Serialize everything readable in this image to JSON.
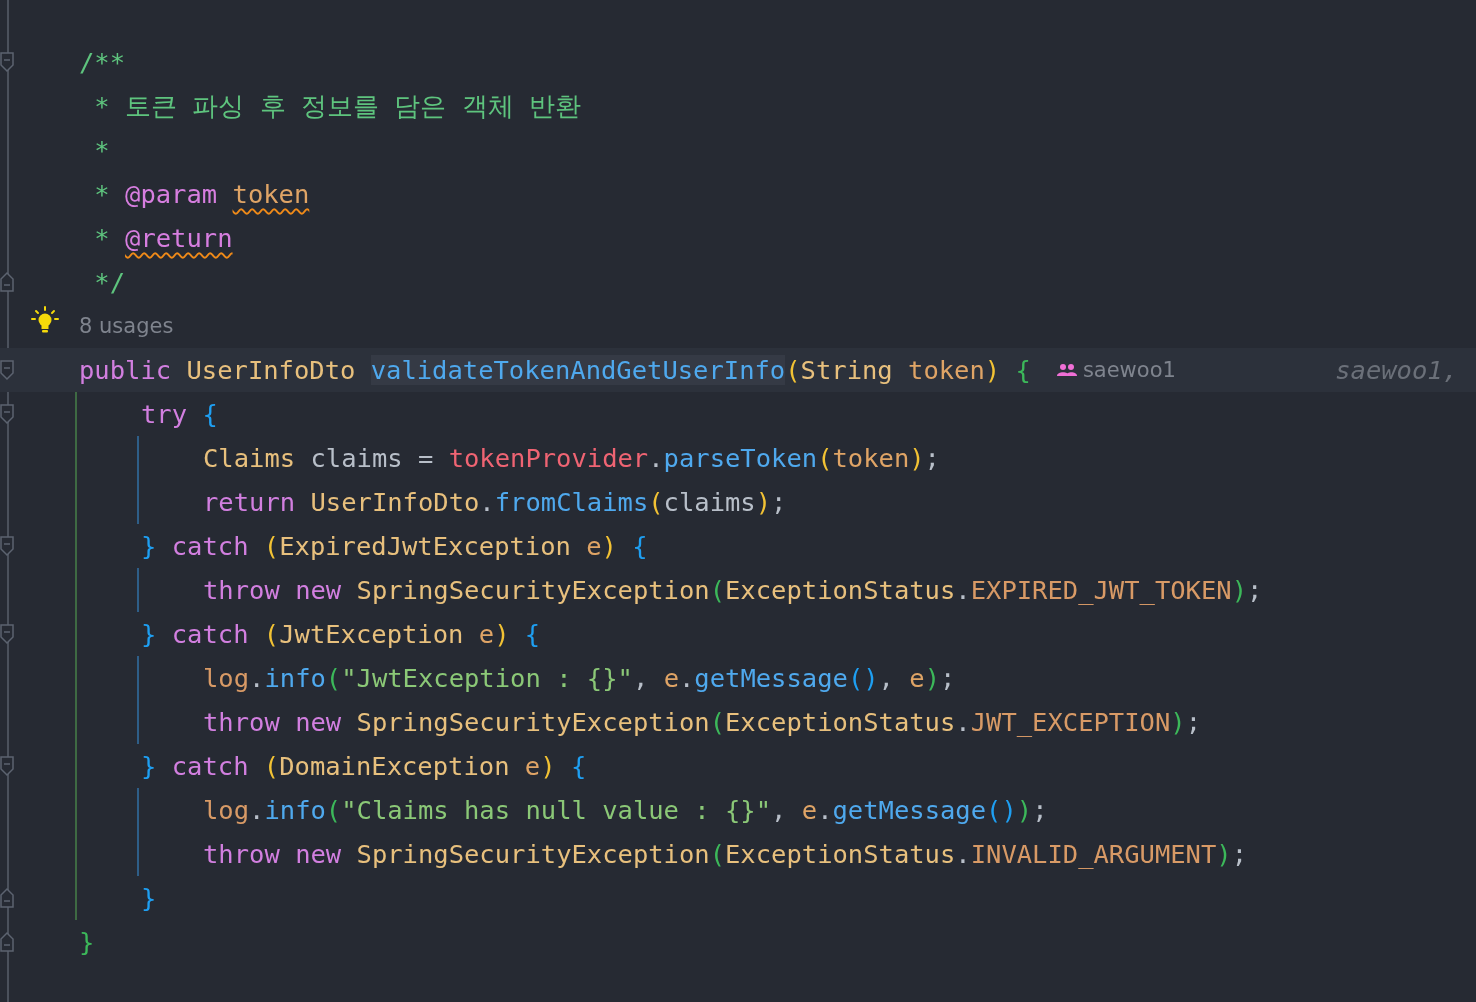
{
  "lines": [
    {
      "kind": "code",
      "fold_open": true,
      "tokens": [
        {
          "text": "/**",
          "kind": "comment"
        }
      ]
    },
    {
      "kind": "code",
      "tokens": [
        {
          "text": " * 토큰 파싱 후 정보를 담은 객체 반환",
          "kind": "comment"
        }
      ]
    },
    {
      "kind": "code",
      "tokens": [
        {
          "text": " *",
          "kind": "comment"
        }
      ]
    },
    {
      "kind": "code",
      "tokens": [
        {
          "text": " * ",
          "kind": "comment"
        },
        {
          "text": "@param ",
          "kind": "doc-tag"
        },
        {
          "text": "token",
          "kind": "param",
          "warning": true
        }
      ]
    },
    {
      "kind": "code",
      "tokens": [
        {
          "text": " * ",
          "kind": "comment"
        },
        {
          "text": "@return",
          "kind": "doc-tag",
          "warning": true
        }
      ]
    },
    {
      "kind": "code",
      "fold_close": true,
      "tokens": [
        {
          "text": " */",
          "kind": "comment"
        }
      ]
    },
    {
      "kind": "usages",
      "text": "8 usages"
    },
    {
      "kind": "code",
      "fold_open": true,
      "current": true,
      "author": "saewoo1",
      "blame": "saewoo1,",
      "tokens": [
        {
          "text": "public ",
          "kind": "keyword"
        },
        {
          "text": "UserInfoDto ",
          "kind": "type"
        },
        {
          "text": "validateTokenAndGetUserInfo",
          "kind": "method-decl"
        },
        {
          "text": "(",
          "kind": "bracket-yellow"
        },
        {
          "text": "String ",
          "kind": "type"
        },
        {
          "text": "token",
          "kind": "param"
        },
        {
          "text": ")",
          "kind": "bracket-yellow"
        },
        {
          "text": " {",
          "kind": "bracket-green"
        }
      ],
      "children": [
        {
          "kind": "code",
          "fold_open": true,
          "tokens": [
            {
              "text": "try ",
              "kind": "keyword"
            },
            {
              "text": "{",
              "kind": "bracket-blue"
            }
          ],
          "children": [
            {
              "kind": "code",
              "tokens": [
                {
                  "text": "Claims ",
                  "kind": "type"
                },
                {
                  "text": "claims = ",
                  "kind": "plain"
                },
                {
                  "text": "tokenProvider",
                  "kind": "field"
                },
                {
                  "text": ".",
                  "kind": "plain"
                },
                {
                  "text": "parseToken",
                  "kind": "method"
                },
                {
                  "text": "(",
                  "kind": "bracket-yellow"
                },
                {
                  "text": "token",
                  "kind": "param"
                },
                {
                  "text": ")",
                  "kind": "bracket-yellow"
                },
                {
                  "text": ";",
                  "kind": "plain"
                }
              ]
            },
            {
              "kind": "code",
              "tokens": [
                {
                  "text": "return ",
                  "kind": "keyword"
                },
                {
                  "text": "UserInfoDto",
                  "kind": "type"
                },
                {
                  "text": ".",
                  "kind": "plain"
                },
                {
                  "text": "fromClaims",
                  "kind": "method"
                },
                {
                  "text": "(",
                  "kind": "bracket-yellow"
                },
                {
                  "text": "claims",
                  "kind": "plain"
                },
                {
                  "text": ")",
                  "kind": "bracket-yellow"
                },
                {
                  "text": ";",
                  "kind": "plain"
                }
              ]
            }
          ]
        },
        {
          "kind": "code",
          "fold_open": true,
          "tokens": [
            {
              "text": "} ",
              "kind": "bracket-blue"
            },
            {
              "text": "catch ",
              "kind": "keyword"
            },
            {
              "text": "(",
              "kind": "bracket-yellow"
            },
            {
              "text": "ExpiredJwtException ",
              "kind": "type"
            },
            {
              "text": "e",
              "kind": "param"
            },
            {
              "text": ")",
              "kind": "bracket-yellow"
            },
            {
              "text": " {",
              "kind": "bracket-blue"
            }
          ],
          "children": [
            {
              "kind": "code",
              "tokens": [
                {
                  "text": "throw ",
                  "kind": "keyword"
                },
                {
                  "text": "new ",
                  "kind": "keyword"
                },
                {
                  "text": "SpringSecurityException",
                  "kind": "type"
                },
                {
                  "text": "(",
                  "kind": "bracket-green"
                },
                {
                  "text": "ExceptionStatus",
                  "kind": "type"
                },
                {
                  "text": ".",
                  "kind": "plain"
                },
                {
                  "text": "EXPIRED_JWT_TOKEN",
                  "kind": "constant"
                },
                {
                  "text": ")",
                  "kind": "bracket-green"
                },
                {
                  "text": ";",
                  "kind": "plain"
                }
              ]
            }
          ]
        },
        {
          "kind": "code",
          "fold_open": true,
          "tokens": [
            {
              "text": "} ",
              "kind": "bracket-blue"
            },
            {
              "text": "catch ",
              "kind": "keyword"
            },
            {
              "text": "(",
              "kind": "bracket-yellow"
            },
            {
              "text": "JwtException ",
              "kind": "type"
            },
            {
              "text": "e",
              "kind": "param"
            },
            {
              "text": ")",
              "kind": "bracket-yellow"
            },
            {
              "text": " {",
              "kind": "bracket-blue"
            }
          ],
          "children": [
            {
              "kind": "code",
              "tokens": [
                {
                  "text": "log",
                  "kind": "constant"
                },
                {
                  "text": ".",
                  "kind": "plain"
                },
                {
                  "text": "info",
                  "kind": "method"
                },
                {
                  "text": "(",
                  "kind": "bracket-green"
                },
                {
                  "text": "\"JwtException : {}\"",
                  "kind": "string"
                },
                {
                  "text": ", ",
                  "kind": "plain"
                },
                {
                  "text": "e",
                  "kind": "param"
                },
                {
                  "text": ".",
                  "kind": "plain"
                },
                {
                  "text": "getMessage",
                  "kind": "method"
                },
                {
                  "text": "()",
                  "kind": "bracket-blue"
                },
                {
                  "text": ", ",
                  "kind": "plain"
                },
                {
                  "text": "e",
                  "kind": "param"
                },
                {
                  "text": ")",
                  "kind": "bracket-green"
                },
                {
                  "text": ";",
                  "kind": "plain"
                }
              ]
            },
            {
              "kind": "code",
              "tokens": [
                {
                  "text": "throw ",
                  "kind": "keyword"
                },
                {
                  "text": "new ",
                  "kind": "keyword"
                },
                {
                  "text": "SpringSecurityException",
                  "kind": "type"
                },
                {
                  "text": "(",
                  "kind": "bracket-green"
                },
                {
                  "text": "ExceptionStatus",
                  "kind": "type"
                },
                {
                  "text": ".",
                  "kind": "plain"
                },
                {
                  "text": "JWT_EXCEPTION",
                  "kind": "constant"
                },
                {
                  "text": ")",
                  "kind": "bracket-green"
                },
                {
                  "text": ";",
                  "kind": "plain"
                }
              ]
            }
          ]
        },
        {
          "kind": "code",
          "fold_open": true,
          "tokens": [
            {
              "text": "} ",
              "kind": "bracket-blue"
            },
            {
              "text": "catch ",
              "kind": "keyword"
            },
            {
              "text": "(",
              "kind": "bracket-yellow"
            },
            {
              "text": "DomainException ",
              "kind": "type"
            },
            {
              "text": "e",
              "kind": "param"
            },
            {
              "text": ")",
              "kind": "bracket-yellow"
            },
            {
              "text": " {",
              "kind": "bracket-blue"
            }
          ],
          "children": [
            {
              "kind": "code",
              "tokens": [
                {
                  "text": "log",
                  "kind": "constant"
                },
                {
                  "text": ".",
                  "kind": "plain"
                },
                {
                  "text": "info",
                  "kind": "method"
                },
                {
                  "text": "(",
                  "kind": "bracket-green"
                },
                {
                  "text": "\"Claims has null value : {}\"",
                  "kind": "string"
                },
                {
                  "text": ", ",
                  "kind": "plain"
                },
                {
                  "text": "e",
                  "kind": "param"
                },
                {
                  "text": ".",
                  "kind": "plain"
                },
                {
                  "text": "getMessage",
                  "kind": "method"
                },
                {
                  "text": "()",
                  "kind": "bracket-blue"
                },
                {
                  "text": ")",
                  "kind": "bracket-green"
                },
                {
                  "text": ";",
                  "kind": "plain"
                }
              ]
            },
            {
              "kind": "code",
              "tokens": [
                {
                  "text": "throw ",
                  "kind": "keyword"
                },
                {
                  "text": "new ",
                  "kind": "keyword"
                },
                {
                  "text": "SpringSecurityException",
                  "kind": "type"
                },
                {
                  "text": "(",
                  "kind": "bracket-green"
                },
                {
                  "text": "ExceptionStatus",
                  "kind": "type"
                },
                {
                  "text": ".",
                  "kind": "plain"
                },
                {
                  "text": "INVALID_ARGUMENT",
                  "kind": "constant"
                },
                {
                  "text": ")",
                  "kind": "bracket-green"
                },
                {
                  "text": ";",
                  "kind": "plain"
                }
              ]
            }
          ]
        },
        {
          "kind": "code",
          "fold_close": true,
          "tokens": [
            {
              "text": "}",
              "kind": "bracket-blue"
            }
          ]
        }
      ]
    },
    {
      "kind": "code",
      "fold_close": true,
      "tokens": [
        {
          "text": "}",
          "kind": "bracket-green"
        }
      ]
    }
  ]
}
